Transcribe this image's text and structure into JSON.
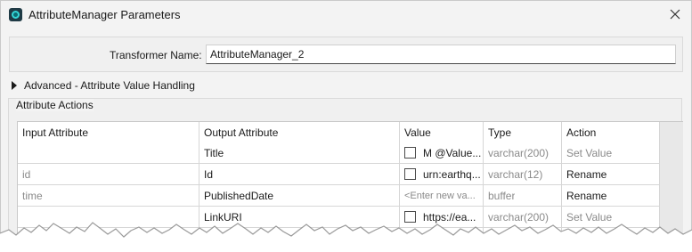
{
  "window": {
    "title": "AttributeManager Parameters"
  },
  "transformer": {
    "label": "Transformer Name:",
    "value": "AttributeManager_2"
  },
  "advanced": {
    "label": "Advanced - Attribute Value Handling"
  },
  "attribute_actions": {
    "title": "Attribute Actions",
    "columns": [
      "Input Attribute",
      "Output Attribute",
      "Value",
      "Type",
      "Action"
    ],
    "rows": [
      {
        "input": "",
        "output": "Title",
        "value": "M @Value...",
        "value_has_checkbox": true,
        "type": "varchar(200)",
        "action": "Set Value"
      },
      {
        "input": "id",
        "output": "Id",
        "value": "urn:earthq...",
        "value_has_checkbox": true,
        "type": "varchar(12)",
        "action": "Rename"
      },
      {
        "input": "time",
        "output": "PublishedDate",
        "value": "<Enter new va...",
        "value_has_checkbox": false,
        "type": "buffer",
        "action": "Rename"
      },
      {
        "input": "",
        "output": "LinkURI",
        "value": "https://ea...",
        "value_has_checkbox": true,
        "type": "varchar(200)",
        "action": "Set Value"
      }
    ]
  },
  "icons": {
    "app": "fme-app-icon",
    "close": "close-icon",
    "expand": "expand-triangle-icon",
    "checkbox": "checkbox-icon"
  }
}
